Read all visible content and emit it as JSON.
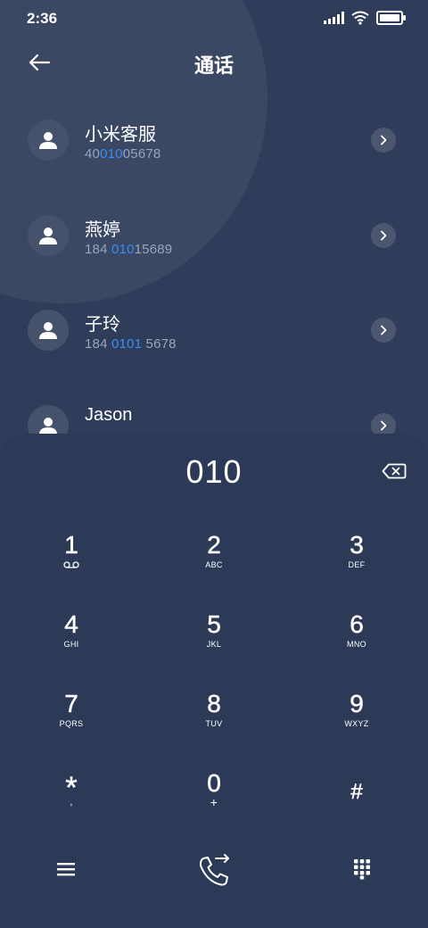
{
  "status": {
    "time": "2:36"
  },
  "header": {
    "title": "通话",
    "back_icon": "arrow-left-icon"
  },
  "contacts": [
    {
      "name": "小米客服",
      "number_parts": [
        {
          "text": "40",
          "highlight": false
        },
        {
          "text": "010",
          "highlight": true
        },
        {
          "text": "05678",
          "highlight": false
        }
      ]
    },
    {
      "name": "燕婷",
      "number_parts": [
        {
          "text": "184 ",
          "highlight": false
        },
        {
          "text": "010",
          "highlight": true
        },
        {
          "text": "15689",
          "highlight": false
        }
      ]
    },
    {
      "name": "子玲",
      "number_parts": [
        {
          "text": "184 ",
          "highlight": false
        },
        {
          "text": "0101",
          "highlight": true
        },
        {
          "text": " 5678",
          "highlight": false
        }
      ]
    },
    {
      "name": "Jason",
      "number_parts": []
    }
  ],
  "dialer": {
    "number": "010",
    "keys": [
      {
        "digit": "1",
        "letters": "voicemail"
      },
      {
        "digit": "2",
        "letters": "ABC"
      },
      {
        "digit": "3",
        "letters": "DEF"
      },
      {
        "digit": "4",
        "letters": "GHI"
      },
      {
        "digit": "5",
        "letters": "JKL"
      },
      {
        "digit": "6",
        "letters": "MNO"
      },
      {
        "digit": "7",
        "letters": "PQRS"
      },
      {
        "digit": "8",
        "letters": "TUV"
      },
      {
        "digit": "9",
        "letters": "WXYZ"
      },
      {
        "digit": "*",
        "letters": ","
      },
      {
        "digit": "0",
        "letters": "+"
      },
      {
        "digit": "#",
        "letters": ""
      }
    ]
  },
  "colors": {
    "background": "#2f3d5b",
    "highlight": "#3a8df0",
    "secondary_text": "#9aa5bd"
  }
}
